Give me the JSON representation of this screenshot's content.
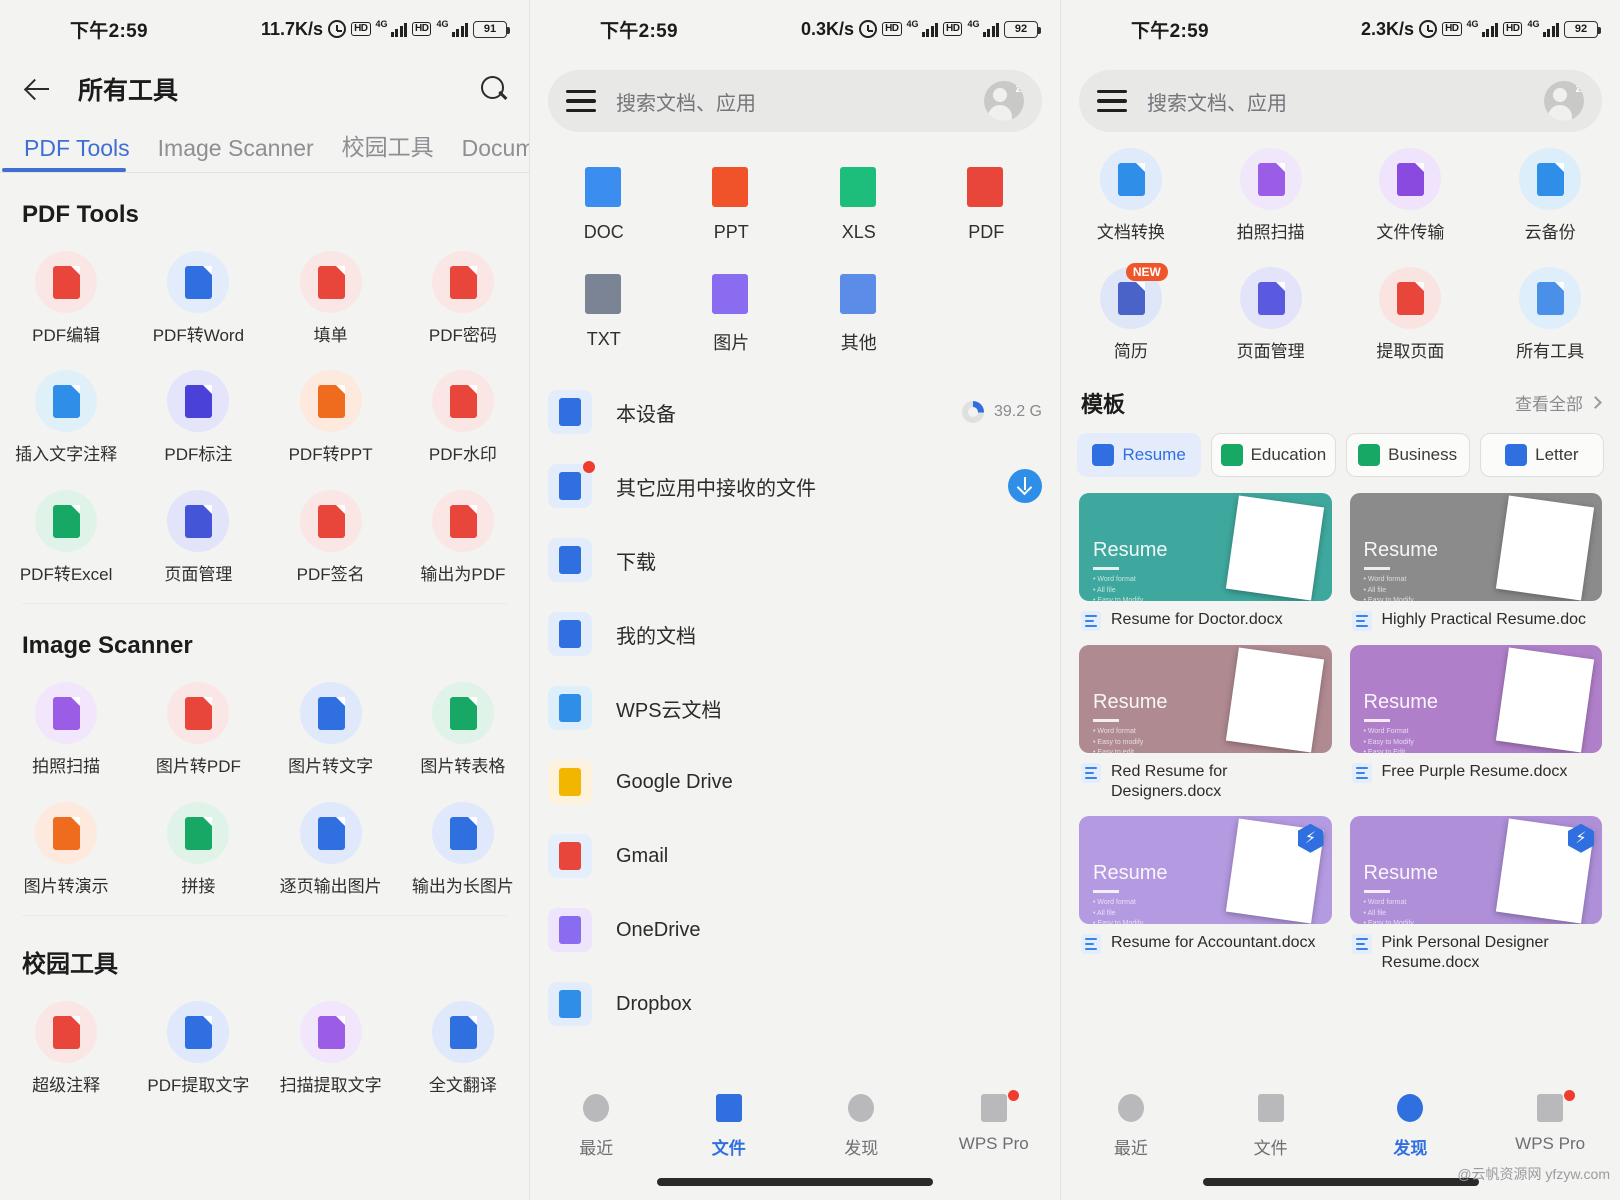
{
  "panels": [
    {
      "status": {
        "time": "下午2:59",
        "speed": "11.7K/s",
        "net1": "4G",
        "net2": "4G",
        "hd": "HD",
        "battery": "91"
      },
      "appbar": {
        "title": "所有工具",
        "back_icon": "back-arrow-icon",
        "search_icon": "search-icon"
      },
      "tabs": [
        {
          "label": "PDF Tools",
          "active": true
        },
        {
          "label": "Image Scanner",
          "active": false
        },
        {
          "label": "校园工具",
          "active": false
        },
        {
          "label": "Document",
          "active": false
        }
      ],
      "sections": [
        {
          "title": "PDF Tools",
          "tools": [
            {
              "label": "PDF编辑",
              "bg": "#fae7e5",
              "fg": "#e8463a",
              "icon": "pdf-edit-icon"
            },
            {
              "label": "PDF转Word",
              "bg": "#e2ecfb",
              "fg": "#2f6fe0",
              "icon": "pdf-to-word-icon"
            },
            {
              "label": "填单",
              "bg": "#fae7e5",
              "fg": "#e8463a",
              "icon": "fill-form-icon"
            },
            {
              "label": "PDF密码",
              "bg": "#fae7e5",
              "fg": "#e8463a",
              "icon": "pdf-password-icon"
            },
            {
              "label": "插入文字注释",
              "bg": "#dff0f8",
              "fg": "#2f8fe8",
              "icon": "insert-text-note-icon"
            },
            {
              "label": "PDF标注",
              "bg": "#e4e4fa",
              "fg": "#4a42d8",
              "icon": "pdf-annotate-icon"
            },
            {
              "label": "PDF转PPT",
              "bg": "#fde9de",
              "fg": "#ef6c1f",
              "icon": "pdf-to-ppt-icon"
            },
            {
              "label": "PDF水印",
              "bg": "#fae7e5",
              "fg": "#e8463a",
              "icon": "pdf-watermark-icon"
            },
            {
              "label": "PDF转Excel",
              "bg": "#dff3e9",
              "fg": "#16a864",
              "icon": "pdf-to-excel-icon"
            },
            {
              "label": "页面管理",
              "bg": "#e2e4fa",
              "fg": "#4455d8",
              "icon": "page-manage-icon"
            },
            {
              "label": "PDF签名",
              "bg": "#fae7e5",
              "fg": "#e8463a",
              "icon": "pdf-sign-icon"
            },
            {
              "label": "输出为PDF",
              "bg": "#fae7e5",
              "fg": "#e8463a",
              "icon": "export-pdf-icon"
            }
          ]
        },
        {
          "title": "Image Scanner",
          "tools": [
            {
              "label": "拍照扫描",
              "bg": "#f1e6fb",
              "fg": "#9b5de5",
              "icon": "photo-scan-icon"
            },
            {
              "label": "图片转PDF",
              "bg": "#fae7e5",
              "fg": "#e8463a",
              "icon": "image-to-pdf-icon"
            },
            {
              "label": "图片转文字",
              "bg": "#dfe9fb",
              "fg": "#2f6fe0",
              "icon": "image-to-text-icon"
            },
            {
              "label": "图片转表格",
              "bg": "#dff3e9",
              "fg": "#16a864",
              "icon": "image-to-table-icon"
            },
            {
              "label": "图片转演示",
              "bg": "#fde9de",
              "fg": "#ef6c1f",
              "icon": "image-to-ppt-icon"
            },
            {
              "label": "拼接",
              "bg": "#dff3e9",
              "fg": "#16a864",
              "icon": "stitch-icon"
            },
            {
              "label": "逐页输出图片",
              "bg": "#dfe9fb",
              "fg": "#2f6fe0",
              "icon": "export-pages-image-icon"
            },
            {
              "label": "输出为长图片",
              "bg": "#dfe9fb",
              "fg": "#2f6fe0",
              "icon": "export-long-image-icon"
            }
          ]
        },
        {
          "title": "校园工具",
          "tools": [
            {
              "label": "超级注释",
              "bg": "#fae7e5",
              "fg": "#e8463a",
              "icon": "super-annotation-icon"
            },
            {
              "label": "PDF提取文字",
              "bg": "#dfe9fb",
              "fg": "#2f6fe0",
              "icon": "pdf-extract-text-icon"
            },
            {
              "label": "扫描提取文字",
              "bg": "#f1e6fb",
              "fg": "#9b5de5",
              "icon": "scan-extract-text-icon"
            },
            {
              "label": "全文翻译",
              "bg": "#dfe9fb",
              "fg": "#2f6fe0",
              "icon": "translate-icon"
            }
          ]
        }
      ]
    },
    {
      "status": {
        "time": "下午2:59",
        "speed": "0.3K/s",
        "net1": "4G",
        "net2": "4G",
        "hd": "HD",
        "battery": "92"
      },
      "search": {
        "placeholder": "搜索文档、应用",
        "menu_icon": "hamburger-menu-icon",
        "avatar_icon": "user-avatar-icon"
      },
      "filetypes": [
        {
          "label": "DOC",
          "color": "#3b8ef0",
          "icon": "doc-file-icon"
        },
        {
          "label": "PPT",
          "color": "#f0522a",
          "icon": "ppt-file-icon"
        },
        {
          "label": "XLS",
          "color": "#1dbd7b",
          "icon": "xls-file-icon"
        },
        {
          "label": "PDF",
          "color": "#e8463a",
          "icon": "pdf-file-icon"
        },
        {
          "label": "TXT",
          "color": "#7b8494",
          "icon": "txt-file-icon"
        },
        {
          "label": "图片",
          "color": "#8a6cf0",
          "icon": "image-file-icon"
        },
        {
          "label": "其他",
          "color": "#5b8de8",
          "icon": "other-file-icon"
        }
      ],
      "locations": [
        {
          "label": "本设备",
          "icon": "device-icon",
          "right_value": "39.2 G",
          "right_type": "ring",
          "badge": false
        },
        {
          "label": "其它应用中接收的文件",
          "icon": "received-files-icon",
          "right_value": "",
          "right_type": "download",
          "badge": true
        },
        {
          "label": "下载",
          "icon": "download-folder-icon",
          "right_value": "",
          "right_type": "",
          "badge": false
        },
        {
          "label": "我的文档",
          "icon": "my-documents-icon",
          "right_value": "",
          "right_type": "",
          "badge": false
        },
        {
          "label": "WPS云文档",
          "icon": "wps-cloud-icon",
          "right_value": "",
          "right_type": "",
          "badge": false
        },
        {
          "label": "Google Drive",
          "icon": "google-drive-icon",
          "right_value": "",
          "right_type": "",
          "badge": false
        },
        {
          "label": "Gmail",
          "icon": "gmail-icon",
          "right_value": "",
          "right_type": "",
          "badge": false
        },
        {
          "label": "OneDrive",
          "icon": "onedrive-icon",
          "right_value": "",
          "right_type": "",
          "badge": false
        },
        {
          "label": "Dropbox",
          "icon": "dropbox-icon",
          "right_value": "",
          "right_type": "",
          "badge": false
        }
      ],
      "bottomnav": [
        {
          "label": "最近",
          "icon": "recent-icon",
          "active": false,
          "dot": false
        },
        {
          "label": "文件",
          "icon": "files-icon",
          "active": true,
          "dot": false
        },
        {
          "label": "发现",
          "icon": "discover-compass-icon",
          "active": false,
          "dot": false
        },
        {
          "label": "WPS Pro",
          "icon": "wps-pro-icon",
          "active": false,
          "dot": true
        }
      ]
    },
    {
      "status": {
        "time": "下午2:59",
        "speed": "2.3K/s",
        "net1": "4G",
        "net2": "4G",
        "hd": "HD",
        "battery": "92"
      },
      "search": {
        "placeholder": "搜索文档、应用",
        "menu_icon": "hamburger-menu-icon",
        "avatar_icon": "user-avatar-icon"
      },
      "tools": [
        {
          "label": "文档转换",
          "bg": "#dfeafb",
          "fg": "#2f8fe8",
          "icon": "doc-convert-icon",
          "badge": ""
        },
        {
          "label": "拍照扫描",
          "bg": "#f1e7fb",
          "fg": "#9b5de5",
          "icon": "photo-scan-icon",
          "badge": ""
        },
        {
          "label": "文件传输",
          "bg": "#efe4fb",
          "fg": "#8a4ae0",
          "icon": "file-transfer-icon",
          "badge": ""
        },
        {
          "label": "云备份",
          "bg": "#ddeefb",
          "fg": "#2f8fe8",
          "icon": "cloud-backup-icon",
          "badge": ""
        },
        {
          "label": "简历",
          "bg": "#dfe6f7",
          "fg": "#4a63c8",
          "icon": "resume-icon",
          "badge": "NEW"
        },
        {
          "label": "页面管理",
          "bg": "#e3e4fa",
          "fg": "#5a5ae0",
          "icon": "page-manage-icon",
          "badge": ""
        },
        {
          "label": "提取页面",
          "bg": "#fae4e2",
          "fg": "#e8463a",
          "icon": "extract-pages-icon",
          "badge": ""
        },
        {
          "label": "所有工具",
          "bg": "#dfeefb",
          "fg": "#4a8fe8",
          "icon": "all-tools-icon",
          "badge": ""
        }
      ],
      "templates": {
        "title": "模板",
        "see_all": "查看全部",
        "chips": [
          {
            "label": "Resume",
            "selected": true,
            "color": "#2f6fe0"
          },
          {
            "label": "Education",
            "selected": false,
            "color": "#16a864"
          },
          {
            "label": "Business",
            "selected": false,
            "color": "#16a864"
          },
          {
            "label": "Letter",
            "selected": false,
            "color": "#2f6fe0"
          }
        ],
        "cards": [
          {
            "name": "Resume for Doctor.docx",
            "bg": "#3fa89e",
            "title": "Resume",
            "pro": false,
            "bullets": "• Word format\n• All file\n• Easy to Modify\n• Easy to Edit"
          },
          {
            "name": "Highly Practical Resume.doc",
            "bg": "#8b8b8b",
            "title": "Resume",
            "pro": false,
            "bullets": "• Word format\n• All file\n• Easy to Modify\n• Easy to Edit"
          },
          {
            "name": "Red Resume for Designers.docx",
            "bg": "#b08a91",
            "title": "Resume",
            "pro": false,
            "bullets": "• Word format\n• Easy to modify\n• Easy to edit"
          },
          {
            "name": "Free Purple Resume.docx",
            "bg": "#b07fc9",
            "title": "Resume",
            "pro": false,
            "bullets": "• Word Format\n• Easy to Modify\n• Easy to Edit"
          },
          {
            "name": "Resume for Accountant.docx",
            "bg": "#b49ae0",
            "title": "Resume",
            "pro": true,
            "bullets": "• Word format\n• All file\n• Easy to Modify\n• Easy to Edit"
          },
          {
            "name": "Pink Personal Designer Resume.docx",
            "bg": "#ae8fd8",
            "title": "Resume",
            "pro": true,
            "bullets": "• Word format\n• All file\n• Easy to Modify\n• Easy to Edit"
          }
        ]
      },
      "bottomnav": [
        {
          "label": "最近",
          "icon": "recent-icon",
          "active": false,
          "dot": false
        },
        {
          "label": "文件",
          "icon": "files-icon",
          "active": false,
          "dot": false
        },
        {
          "label": "发现",
          "icon": "discover-compass-icon",
          "active": true,
          "dot": false
        },
        {
          "label": "WPS Pro",
          "icon": "wps-pro-icon",
          "active": false,
          "dot": true
        }
      ],
      "watermark": "@云帆资源网 yfzyw.com"
    }
  ]
}
